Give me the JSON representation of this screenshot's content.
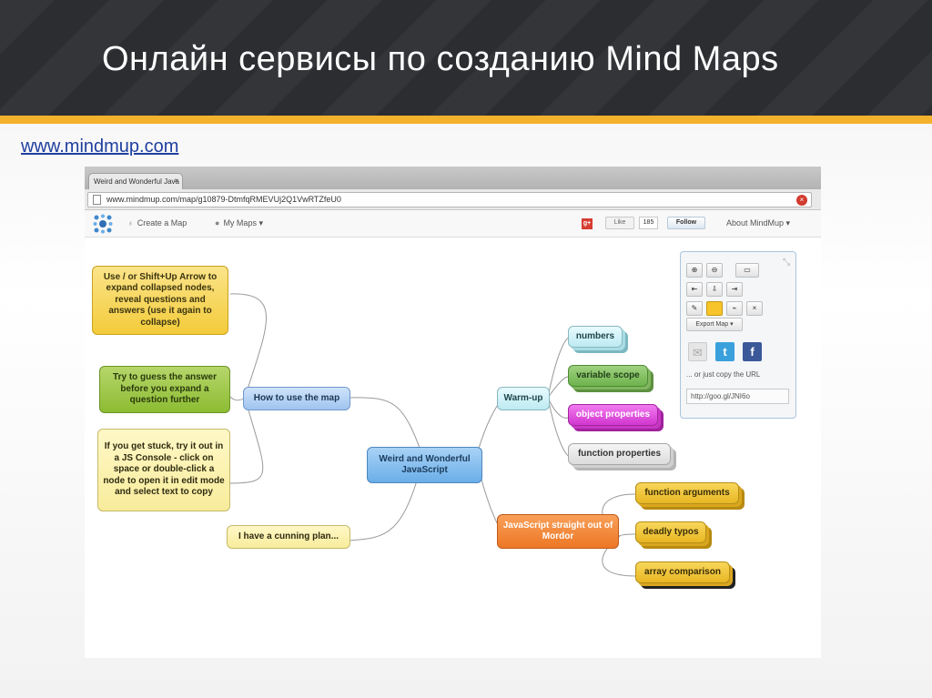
{
  "slide": {
    "title": "Онлайн сервисы по созданию Mind Maps",
    "link": "www.mindmup.com"
  },
  "browser": {
    "tab_title": "Weird and Wonderful Java",
    "tab_close": "×",
    "url": "www.mindmup.com/map/g10879-DtmfqRMEVUj2Q1VwRTZfeU0",
    "stop": "×"
  },
  "appnav": {
    "create_map": "Create a Map",
    "my_maps": "My Maps ▾",
    "gplus": "g+",
    "like": "Like",
    "like_count": "185",
    "follow": "Follow",
    "about": "About MindMup ▾"
  },
  "mindmap": {
    "center": "Weird and Wonderful JavaScript",
    "how_to": "How to use the map",
    "tip1": "Use / or Shift+Up Arrow to expand collapsed nodes, reveal questions and answers (use it again to collapse)",
    "tip2": "Try to guess the answer before you expand a question further",
    "tip3": "If you get stuck, try it out in a JS Console - click on space or double-click a node to open it in edit mode and select text to copy",
    "cunning": "I have a cunning plan...",
    "warmup": "Warm-up",
    "numbers": "numbers",
    "variable_scope": "variable scope",
    "object_properties": "object properties",
    "function_properties": "function properties",
    "mordor": "JavaScript straight out of Mordor",
    "function_arguments": "function arguments",
    "deadly_typos": "deadly typos",
    "array_comparison": "array comparison"
  },
  "toolbar": {
    "export_map": "Export Map ▾",
    "copy_text": "... or just copy the URL",
    "short_url": "http://goo.gl/JNI6o",
    "icons": [
      "zoom-in-icon",
      "zoom-out-icon",
      "keyboard-icon",
      "move-left-icon",
      "download-icon",
      "move-right-icon",
      "pencil-icon",
      "color-swatch-icon",
      "unlink-icon",
      "delete-icon",
      "email-icon",
      "twitter-icon",
      "facebook-icon"
    ]
  },
  "colors": {
    "header_bg": "#2b2d31",
    "accent_stripe": "#f3b12c",
    "link": "#1f3f9f"
  }
}
